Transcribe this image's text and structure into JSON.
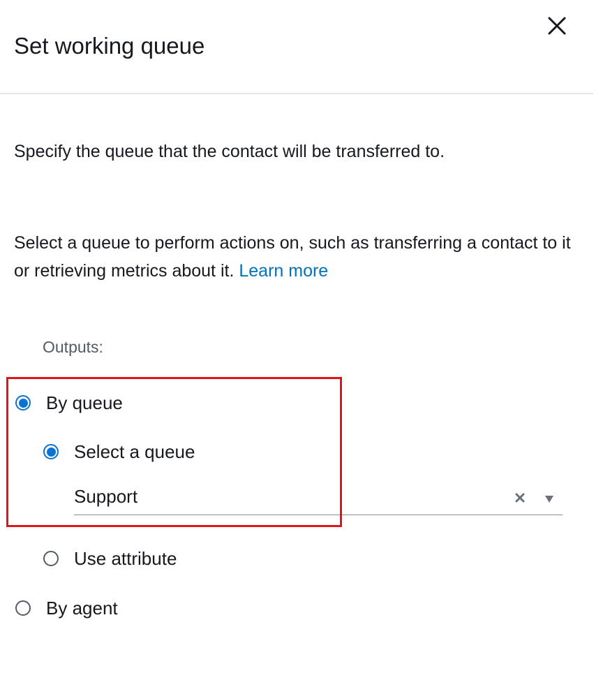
{
  "panel": {
    "title": "Set working queue",
    "description": "Specify the queue that the contact will be transferred to.",
    "help_text": "Select a queue to perform actions on, such as transferring a contact to it or retrieving metrics about it.",
    "learn_more": "Learn more"
  },
  "outputs": {
    "label": "Outputs:",
    "by_queue": {
      "label": "By queue",
      "checked": true
    },
    "select_queue": {
      "label": "Select a queue",
      "checked": true,
      "value": "Support"
    },
    "use_attribute": {
      "label": "Use attribute",
      "checked": false
    },
    "by_agent": {
      "label": "By agent",
      "checked": false
    }
  },
  "icons": {
    "close": "close-icon",
    "clear": "clear-icon",
    "dropdown": "caret-down-icon"
  },
  "colors": {
    "accent": "#0972d3",
    "link": "#0073bb",
    "highlight": "#e0131b"
  }
}
